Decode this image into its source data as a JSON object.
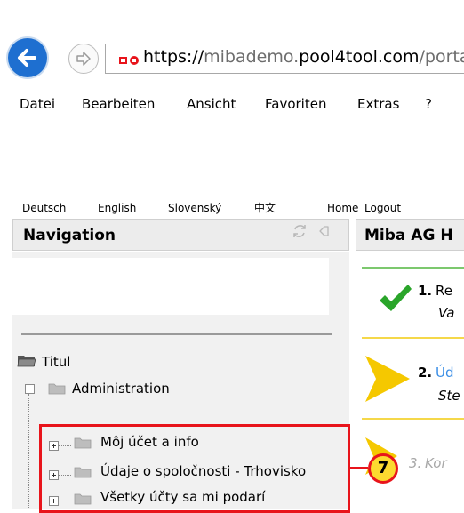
{
  "browser": {
    "url_scheme": "https://",
    "url_sub": "mibademo.",
    "url_domain": "pool4tool.com",
    "url_path": "/portal/r",
    "menu": [
      "Datei",
      "Bearbeiten",
      "Ansicht",
      "Favoriten",
      "Extras",
      "?"
    ]
  },
  "page": {
    "languages": [
      "Deutsch",
      "English",
      "Slovenský",
      "中文"
    ],
    "top_links": [
      "Home",
      "Logout"
    ],
    "nav_title": "Navigation",
    "main_title": "Miba AG H"
  },
  "tree": {
    "root": "Titul",
    "admin": "Administration",
    "items": [
      "Môj účet a info",
      "Údaje o spoločnosti - Trhovisko",
      "Všetky účty sa mi podarí"
    ]
  },
  "steps": [
    {
      "number": "1.",
      "title": "Re",
      "subtitle": "Va",
      "status": "done"
    },
    {
      "number": "2.",
      "title": "Úd",
      "subtitle": "Ste",
      "status": "active"
    },
    {
      "number": "3.",
      "title": "Kor",
      "subtitle": "",
      "status": "pending"
    }
  ],
  "annotation": {
    "label": "7"
  },
  "colors": {
    "accent_blue": "#1e6fd0",
    "annotation_red": "#e8141b",
    "annotation_yellow": "#fcd930",
    "check_green": "#2aa52a",
    "arrow_yellow": "#f5c800"
  }
}
